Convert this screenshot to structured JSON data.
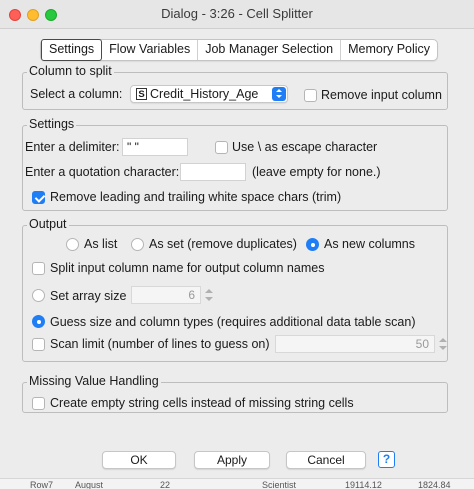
{
  "window": {
    "title": "Dialog - 3:26 - Cell Splitter"
  },
  "tabs": [
    "Settings",
    "Flow Variables",
    "Job Manager Selection",
    "Memory Policy"
  ],
  "column_group": {
    "label": "Column to split",
    "select_label": "Select a column:",
    "selected_type": "S",
    "selected_column": "Credit_History_Age",
    "remove_input_label": "Remove input column"
  },
  "settings_group": {
    "label": "Settings",
    "delimiter_label": "Enter a delimiter:",
    "delimiter_value": "\" \"",
    "escape_label": "Use \\ as escape character",
    "quotation_label": "Enter a quotation character:",
    "quotation_value": "",
    "quotation_hint": "(leave empty for none.)",
    "trim_label": "Remove leading and trailing white space chars (trim)"
  },
  "output_group": {
    "label": "Output",
    "as_list": "As list",
    "as_set": "As set (remove duplicates)",
    "as_new_columns": "As new columns",
    "split_names_label": "Split input column name for output column names",
    "set_array_size_label": "Set array size",
    "array_size_value": "6",
    "guess_label": "Guess size and column types (requires additional data table scan)",
    "scan_limit_label": "Scan limit (number of lines to guess on)",
    "scan_limit_value": "50"
  },
  "missing_group": {
    "label": "Missing Value Handling",
    "empty_cells_label": "Create empty string cells instead of missing string cells"
  },
  "buttons": {
    "ok": "OK",
    "apply": "Apply",
    "cancel": "Cancel",
    "help": "?"
  },
  "background_row": [
    "Row7",
    "August",
    "22",
    "Scientist",
    "19114.12",
    "1824.84"
  ]
}
